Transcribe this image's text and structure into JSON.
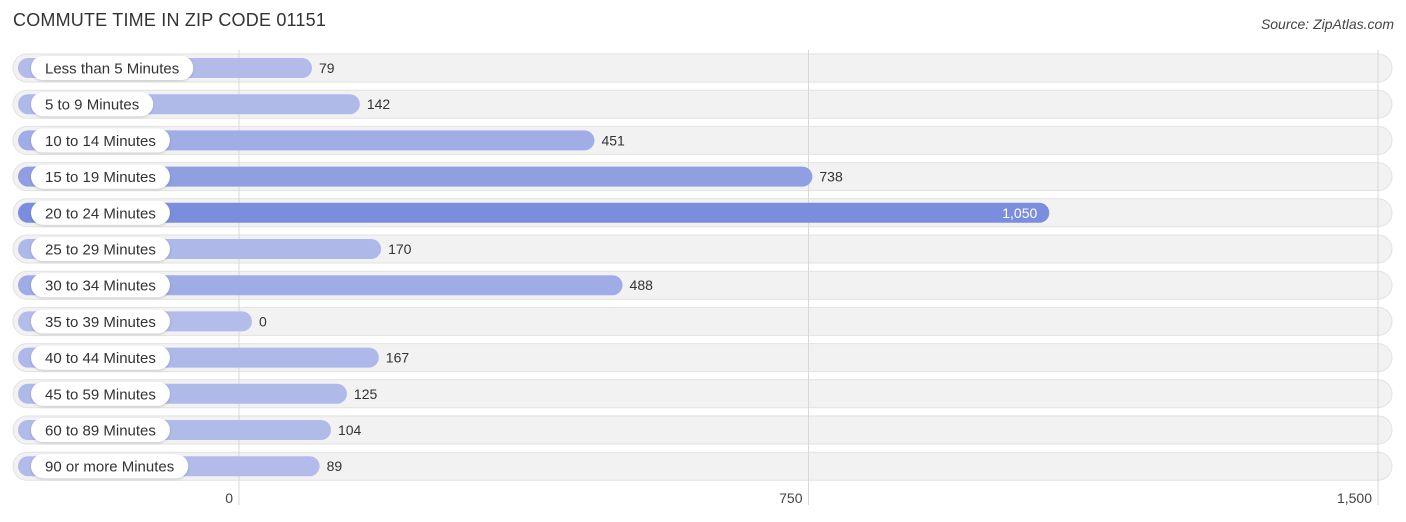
{
  "header": {
    "title": "COMMUTE TIME IN ZIP CODE 01151",
    "source": "Source: ZipAtlas.com"
  },
  "chart_data": {
    "type": "bar",
    "orientation": "horizontal",
    "title": "COMMUTE TIME IN ZIP CODE 01151",
    "xlabel": "",
    "ylabel": "",
    "categories": [
      "Less than 5 Minutes",
      "5 to 9 Minutes",
      "10 to 14 Minutes",
      "15 to 19 Minutes",
      "20 to 24 Minutes",
      "25 to 29 Minutes",
      "30 to 34 Minutes",
      "35 to 39 Minutes",
      "40 to 44 Minutes",
      "45 to 59 Minutes",
      "60 to 89 Minutes",
      "90 or more Minutes"
    ],
    "values": [
      79,
      142,
      451,
      738,
      1050,
      170,
      488,
      0,
      167,
      125,
      104,
      89
    ],
    "value_labels": [
      "79",
      "142",
      "451",
      "738",
      "1,050",
      "170",
      "488",
      "0",
      "167",
      "125",
      "104",
      "89"
    ],
    "xlim": [
      0,
      1500
    ],
    "xticks": [
      0,
      750,
      1500
    ],
    "xtick_labels": [
      "0",
      "750",
      "1,500"
    ],
    "grid": true,
    "legend": "none",
    "colors": {
      "light": "#b4bdea",
      "dark": "#7b8edd",
      "track": "#f2f2f2",
      "grid": "#d8d8d8"
    }
  }
}
